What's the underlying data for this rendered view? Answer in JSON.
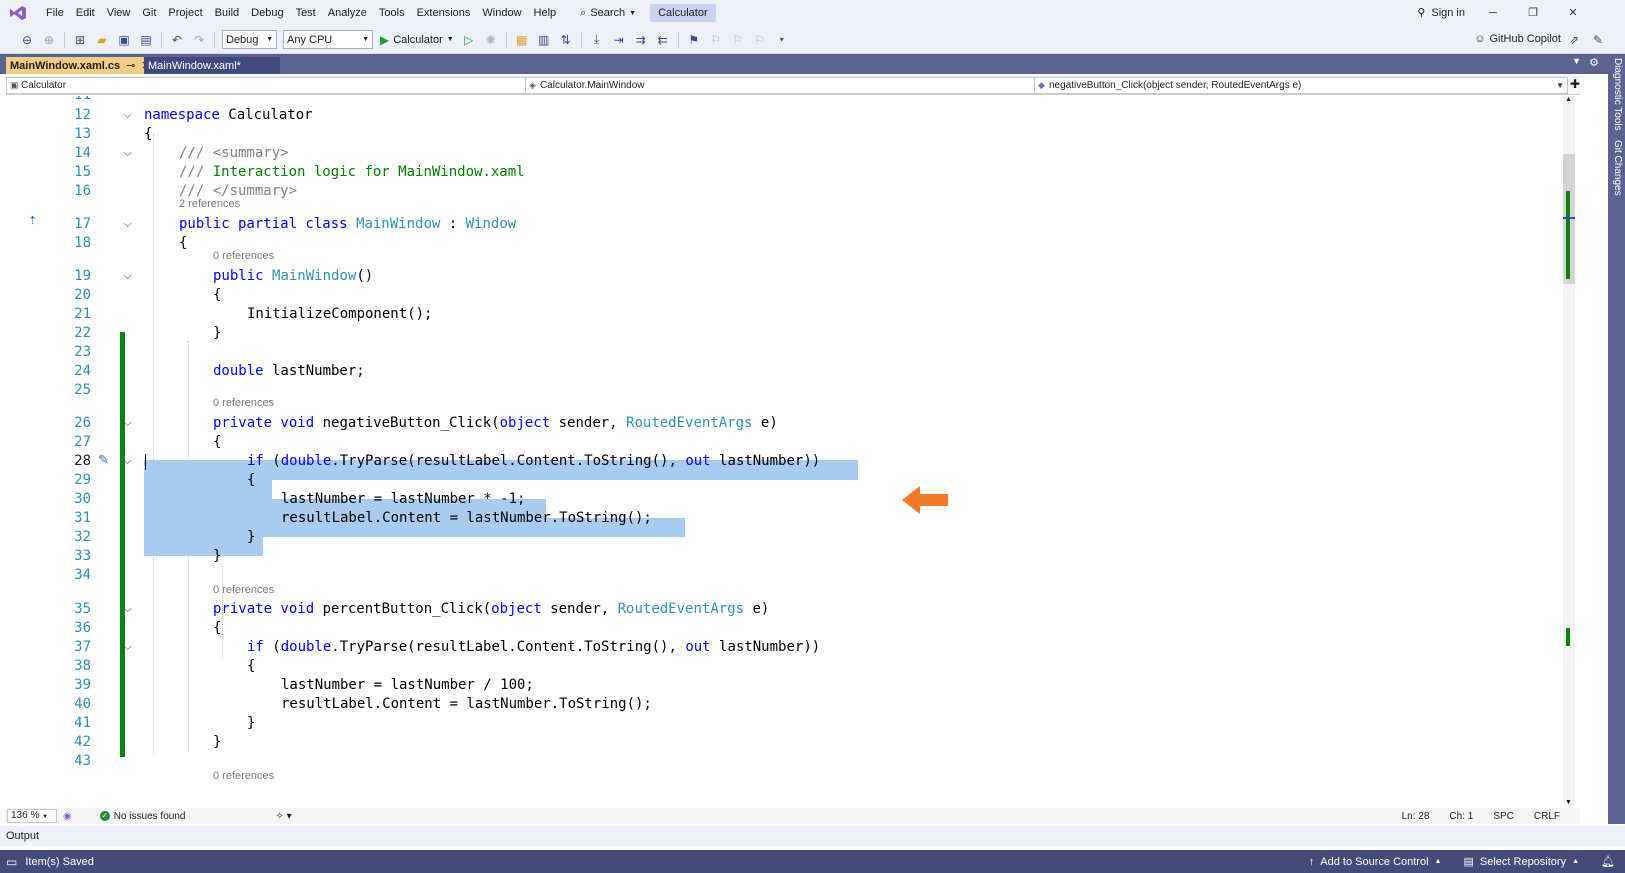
{
  "menubar": {
    "items": [
      "File",
      "Edit",
      "View",
      "Git",
      "Project",
      "Build",
      "Debug",
      "Test",
      "Analyze",
      "Tools",
      "Extensions",
      "Window",
      "Help"
    ],
    "search_label": "Search",
    "solution_name": "Calculator",
    "signin_label": "Sign in"
  },
  "toolbar": {
    "config": "Debug",
    "platform": "Any CPU",
    "run_target": "Calculator",
    "copilot_label": "GitHub Copilot"
  },
  "tabs": [
    {
      "label": "MainWindow.xaml.cs",
      "pin": "⊸",
      "active": true
    },
    {
      "label": "MainWindow.xaml*",
      "active": false
    }
  ],
  "tool_rail": [
    "Diagnostic Tools",
    "Git Changes"
  ],
  "navbar": {
    "project": "Calculator",
    "type": "Calculator.MainWindow",
    "member": "negativeButton_Click(object sender, RoutedEventArgs e)"
  },
  "editor": {
    "top_line": "11",
    "lines": [
      {
        "n": "12"
      },
      {
        "n": "13"
      },
      {
        "n": "14"
      },
      {
        "n": "15"
      },
      {
        "n": "16"
      },
      {
        "n": "17"
      },
      {
        "n": "18"
      },
      {
        "n": "19"
      },
      {
        "n": "20"
      },
      {
        "n": "21"
      },
      {
        "n": "22"
      },
      {
        "n": "23"
      },
      {
        "n": "24"
      },
      {
        "n": "25"
      },
      {
        "n": "26"
      },
      {
        "n": "27"
      },
      {
        "n": "28"
      },
      {
        "n": "29"
      },
      {
        "n": "30"
      },
      {
        "n": "31"
      },
      {
        "n": "32"
      },
      {
        "n": "33"
      },
      {
        "n": "34"
      },
      {
        "n": "35"
      },
      {
        "n": "36"
      },
      {
        "n": "37"
      },
      {
        "n": "38"
      },
      {
        "n": "39"
      },
      {
        "n": "40"
      },
      {
        "n": "41"
      },
      {
        "n": "42"
      },
      {
        "n": "43"
      }
    ],
    "code": {
      "l12_kw": "namespace",
      "l12_name": " Calculator",
      "brace_open": "{",
      "brace_close": "}",
      "l14": "/// <summary>",
      "l15_tag": "///",
      "l15_text": " Interaction logic for MainWindow.xaml",
      "l16": "/// </summary>",
      "refs2": "2 references",
      "l17_kw": "public partial class",
      "l17_name": "MainWindow",
      "l17_colon": " : ",
      "l17_base": "Window",
      "refs0": "0 references",
      "l19_kw": "public",
      "l19_name": "MainWindow",
      "l19_tail": "()",
      "l21": "InitializeComponent();",
      "l24_kw": "double",
      "l24_tail": " lastNumber;",
      "l26_kw": "private void",
      "l26_method": " negativeButton_Click(",
      "l26_obj": "object",
      "l26_mid": " sender, ",
      "l26_type": "RoutedEventArgs",
      "l26_tail": " e)",
      "if_kw": "if",
      "if_paren": " (",
      "if_double": "double",
      "if_mid": ".TryParse(resultLabel.Content.ToString(), ",
      "if_out": "out",
      "if_tail": " lastNumber))",
      "l30": "lastNumber = lastNumber * -1;",
      "l31": "resultLabel.Content = lastNumber.ToString();",
      "l35_method": " percentButton_Click(",
      "l39": "lastNumber = lastNumber / 100;",
      "l40": "resultLabel.Content = lastNumber.ToString();"
    },
    "refs_bottom": "0 references",
    "arrow_color": "#f07a28"
  },
  "editor_status": {
    "zoom": "136 %",
    "issues": "No issues found",
    "ln": "Ln: 28",
    "ch": "Ch: 1",
    "spc": "SPC",
    "eol": "CRLF"
  },
  "output_label": "Output",
  "statusbar": {
    "saved": "Item(s) Saved",
    "source_control": "Add to Source Control",
    "repo": "Select Repository"
  }
}
